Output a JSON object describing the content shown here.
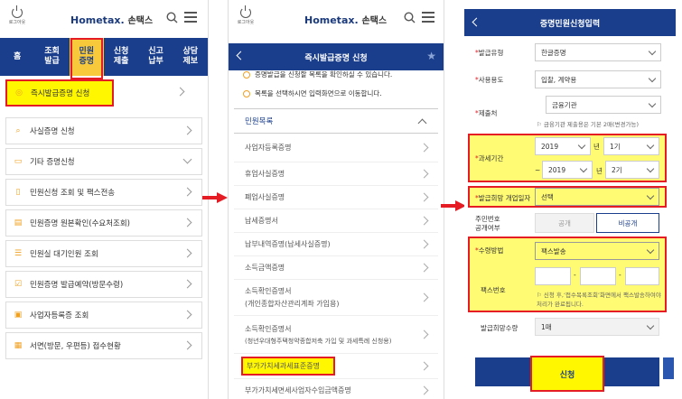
{
  "brand": {
    "logo_en": "Hometax.",
    "logo_kr": "손택스",
    "logout": "로그아웃"
  },
  "panel1": {
    "nav": [
      "홈",
      "조회\n발급",
      "민원\n증명",
      "신청\n제출",
      "신고\n납부",
      "상담\n제보"
    ],
    "items": [
      {
        "label": "즉시발급증명 신청",
        "icon": "certificate-icon"
      },
      {
        "label": "사실증명 신청",
        "icon": "search-icon"
      },
      {
        "label": "기타 증명신청",
        "icon": "monitor-icon"
      },
      {
        "label": "민원신청 조회 및 팩스전송",
        "icon": "clipboard-icon"
      },
      {
        "label": "민원증명 원본확인(수요처조회)",
        "icon": "document-check-icon"
      },
      {
        "label": "민원실 대기인원 조회",
        "icon": "database-icon"
      },
      {
        "label": "민원증명 발급예약(방문수령)",
        "icon": "checkbox-icon"
      },
      {
        "label": "사업자등록증 조회",
        "icon": "folder-icon"
      },
      {
        "label": "서면(방문, 우편등) 접수현황",
        "icon": "grid-icon"
      }
    ]
  },
  "panel2": {
    "title": "즉시발급증명 신청",
    "notes": [
      "증명발급을 신청할 목록을 확인하실 수 있습니다.",
      "목록을 선택하시면 입력화면으로 이동합니다."
    ],
    "section": "민원목록",
    "items": [
      {
        "label": "사업자등록증명",
        "sub": ""
      },
      {
        "label": "휴업사실증명",
        "sub": ""
      },
      {
        "label": "폐업사실증명",
        "sub": ""
      },
      {
        "label": "납세증명서",
        "sub": ""
      },
      {
        "label": "납부내역증명(납세사실증명)",
        "sub": ""
      },
      {
        "label": "소득금액증명",
        "sub": ""
      },
      {
        "label": "소득확인증명서",
        "sub": "(개인종합자산관리계좌 가입용)"
      },
      {
        "label": "소득확인증명서",
        "sub": "(청년우대형주택청약종합저축 가입 및 과세특례 신청용)"
      },
      {
        "label": "부가가치세과세표준증명",
        "sub": ""
      },
      {
        "label": "부가가치세면세사업자수입금액증명",
        "sub": ""
      }
    ]
  },
  "panel3": {
    "title": "증명민원신청입력",
    "issue_type_label": "발급유형",
    "issue_type": "한글증명",
    "usage_label": "사용용도",
    "usage": "입찰, 계약용",
    "submit_label": "제출처",
    "submit_to": "금융기관",
    "submit_note": "금융기관 제출용은 기본 2매(변경가능)",
    "period_label": "과세기간",
    "from_year": "2019",
    "from_unit": "년",
    "from_term": "1기",
    "tilde": "~",
    "to_year": "2019",
    "to_unit": "년",
    "to_term": "2기",
    "open_date_label": "발급희망 개업일자",
    "open_date": "선택",
    "rrn_label": "주민번호\n공개여부",
    "rrn_open": "공개",
    "rrn_closed": "비공개",
    "receive_label": "수령방법",
    "receive": "팩스발송",
    "fax_label": "팩스번호",
    "fax_dash": "-",
    "fax_note": "신청 후,‘접수목록조회’화면에서 팩스발송하여야 처리가 완료됩니다.",
    "copies_label": "발급희망수량",
    "copies": "1매",
    "submit_button": "신청"
  },
  "colors": {
    "brand_blue": "#1a3e8c",
    "highlight": "#f7c93b",
    "annotation": "#e51c23"
  }
}
